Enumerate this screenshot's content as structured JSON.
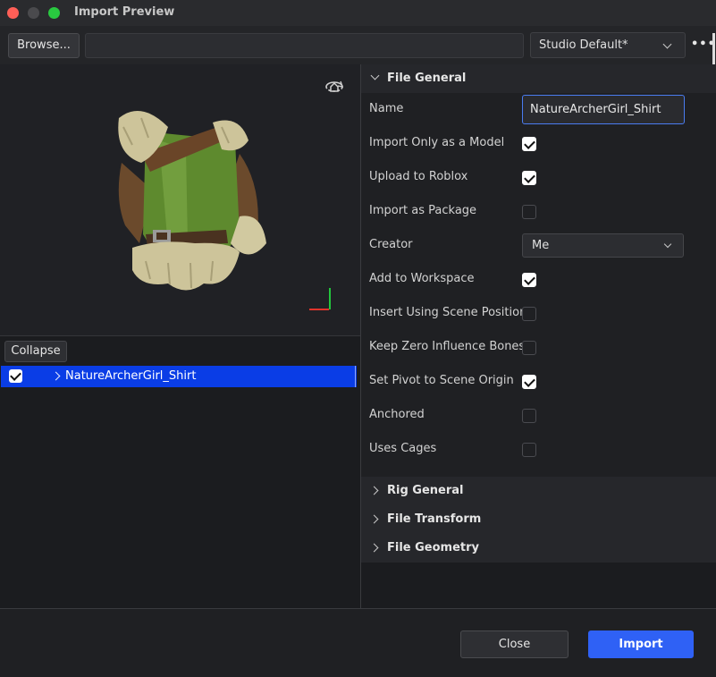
{
  "window": {
    "title": "Import Preview"
  },
  "toolbar": {
    "browse_label": "Browse...",
    "path_value": "",
    "preset_value": "Studio Default*",
    "more_label": "•••"
  },
  "left": {
    "collapse_label": "Collapse",
    "tree": [
      {
        "label": "NatureArcherGirl_Shirt",
        "checked": true,
        "selected": true
      }
    ]
  },
  "sections": {
    "file_general": "File General",
    "rig_general": "Rig General",
    "file_transform": "File Transform",
    "file_geometry": "File Geometry"
  },
  "props": {
    "name": {
      "label": "Name",
      "value": "NatureArcherGirl_Shirt"
    },
    "import_only_model": {
      "label": "Import Only as a Model",
      "checked": true
    },
    "upload_roblox": {
      "label": "Upload to Roblox",
      "checked": true
    },
    "import_package": {
      "label": "Import as Package",
      "checked": false
    },
    "creator": {
      "label": "Creator",
      "value": "Me"
    },
    "add_workspace": {
      "label": "Add to Workspace",
      "checked": true
    },
    "scene_position": {
      "label": "Insert Using Scene Position",
      "checked": false
    },
    "zero_influence": {
      "label": "Keep Zero Influence Bones",
      "checked": false
    },
    "pivot_origin": {
      "label": "Set Pivot to Scene Origin",
      "checked": true
    },
    "anchored": {
      "label": "Anchored",
      "checked": false
    },
    "uses_cages": {
      "label": "Uses Cages",
      "checked": false
    }
  },
  "footer": {
    "close_label": "Close",
    "import_label": "Import"
  },
  "colors": {
    "accent": "#2f61f5",
    "selection": "#0a3de6"
  }
}
